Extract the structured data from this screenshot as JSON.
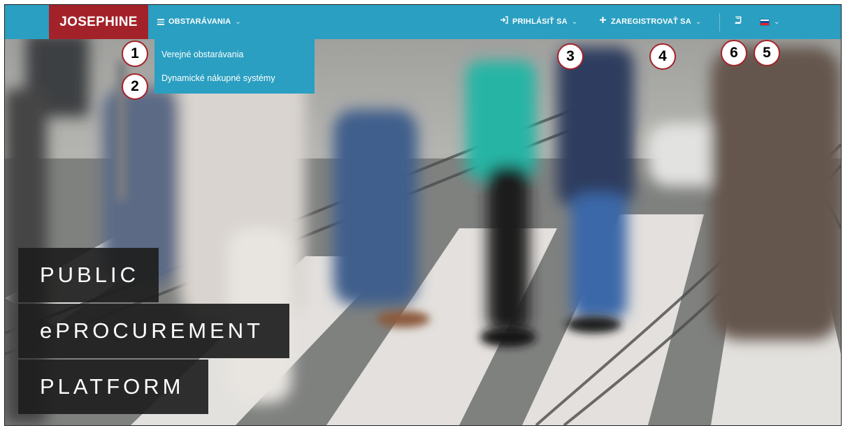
{
  "brand": {
    "name": "JOSEPHINE"
  },
  "navbar": {
    "menu_label": "OBSTARÁVANIA",
    "login_label": "PRIHLÁSIŤ SA",
    "register_label": "ZAREGISTROVAŤ SA",
    "accent_color": "#2a9fc1",
    "brand_color": "#a3222a",
    "icons": {
      "menu": "hamburger-icon",
      "login": "sign-in-icon",
      "register": "plus-icon",
      "doc": "book-icon",
      "lang": "slovak-flag-icon"
    }
  },
  "dropdown": {
    "items": [
      {
        "label": "Verejné obstarávania"
      },
      {
        "label": "Dynamické nákupné systémy"
      }
    ]
  },
  "hero": {
    "lines": [
      "PUBLIC",
      "ePROCUREMENT",
      "PLATFORM"
    ]
  },
  "callouts": [
    "1",
    "2",
    "3",
    "4",
    "5",
    "6"
  ]
}
